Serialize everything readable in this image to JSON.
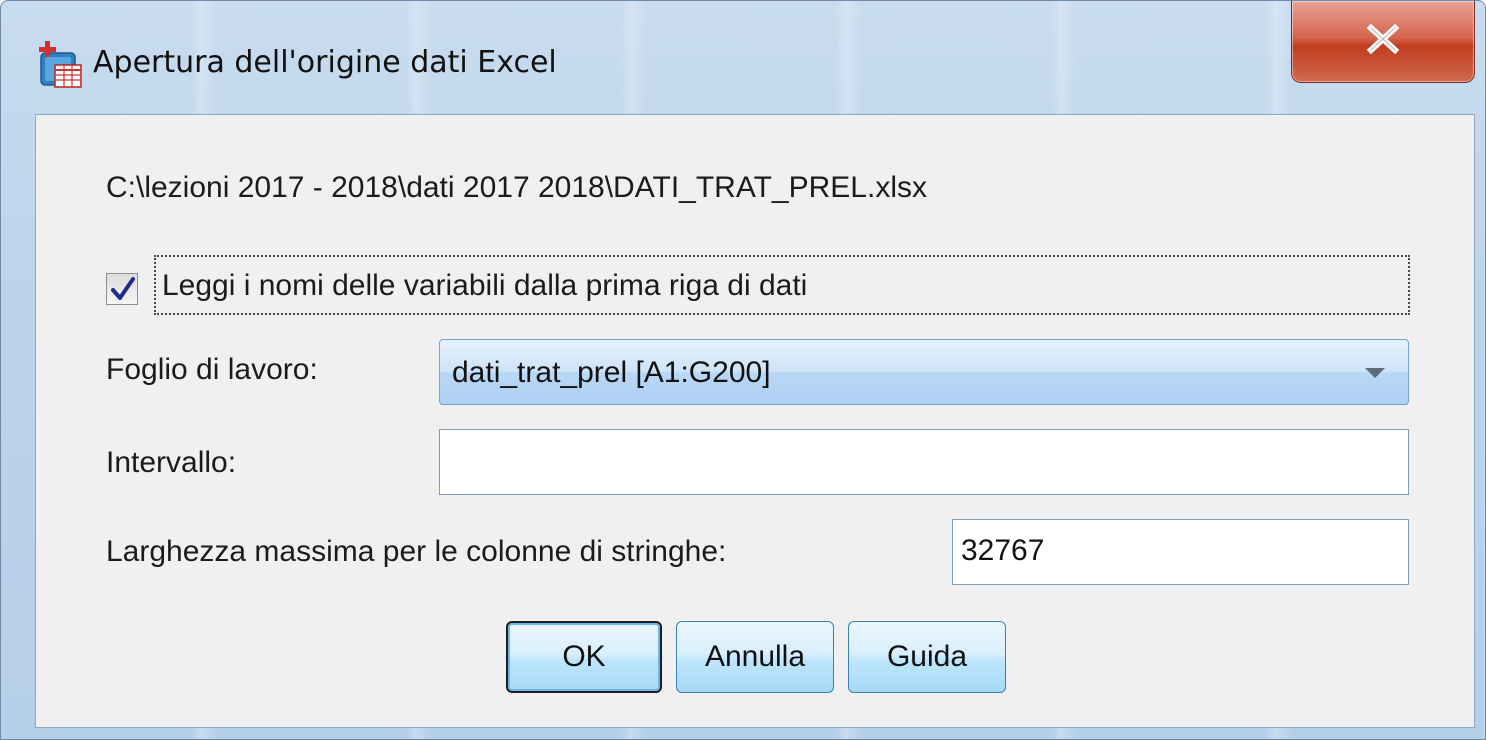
{
  "window": {
    "title": "Apertura dell'origine dati Excel",
    "close_label": "X",
    "app_icon": "spss-data-icon"
  },
  "dialog": {
    "file_path": "C:\\lezioni 2017 - 2018\\dati 2017 2018\\DATI_TRAT_PREL.xlsx",
    "read_names_checkbox": {
      "label": "Leggi i nomi delle variabili dalla prima riga di dati",
      "checked": true
    },
    "worksheet": {
      "label": "Foglio di lavoro:",
      "value": "dati_trat_prel [A1:G200]"
    },
    "range": {
      "label": "Intervallo:",
      "value": ""
    },
    "max_string_width": {
      "label": "Larghezza massima per le colonne di stringhe:",
      "value": "32767"
    },
    "buttons": {
      "ok": "OK",
      "cancel": "Annulla",
      "help": "Guida"
    }
  },
  "colors": {
    "close_button": "#c9492b",
    "button_face": "#bee6fd",
    "dialog_bg": "#f0f0f0"
  }
}
